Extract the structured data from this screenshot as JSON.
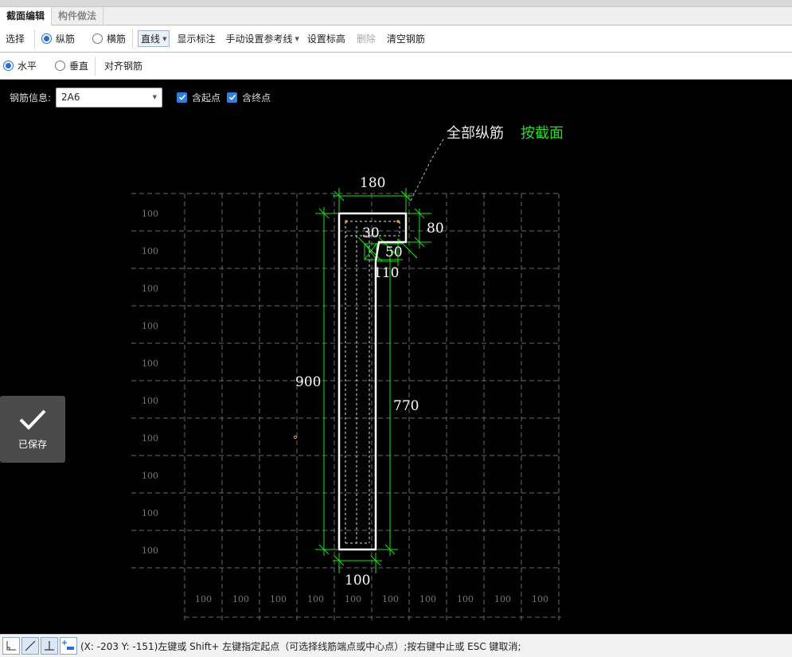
{
  "tabs": [
    {
      "label": "截面编辑"
    },
    {
      "label": "构件做法"
    }
  ],
  "toolbar1": {
    "select": "选择",
    "longitudinal": "纵筋",
    "transverse": "横筋",
    "line_mode": "直线",
    "show_dimensions": "显示标注",
    "manual_ref_line": "手动设置参考线",
    "set_elevation": "设置标高",
    "delete": "删除",
    "clear_rebar": "清空钢筋"
  },
  "toolbar2": {
    "horizontal": "水平",
    "vertical": "垂直",
    "align_rebar": "对齐钢筋"
  },
  "info": {
    "rebar_info_label": "钢筋信息:",
    "rebar_value": "2A6",
    "include_start": "含起点",
    "include_end": "含终点"
  },
  "drawing": {
    "all_long_rebar": "全部纵筋",
    "by_section": "按截面",
    "dim_top": "180",
    "dim_right_small": "80",
    "dim_30": "30",
    "dim_50": "50",
    "dim_110": "110",
    "dim_left": "900",
    "dim_right": "770",
    "dim_bottom": "100",
    "grid_label": "100",
    "grid_left_labels": [
      "100",
      "100",
      "100",
      "100",
      "100",
      "100",
      "100",
      "100",
      "100"
    ],
    "grid_bottom_labels": [
      "100",
      "100",
      "100",
      "100",
      "100",
      "100",
      "100",
      "100",
      "100",
      "100"
    ],
    "colors": {
      "dim": "#18e018",
      "outline": "#ffffff",
      "grid": "#6a6a6a",
      "label_green": "#22dd22"
    }
  },
  "toast": {
    "label": "已保存"
  },
  "status": {
    "text": "(X: -203 Y: -151)左键或 Shift+ 左键指定起点（可选择线筋端点或中心点）;按右键中止或 ESC 键取消;"
  }
}
